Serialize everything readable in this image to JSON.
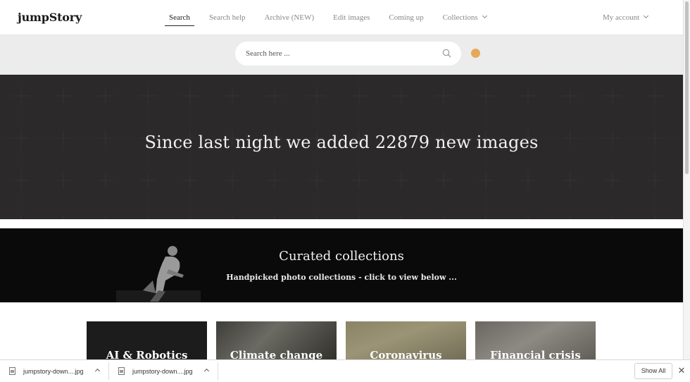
{
  "header": {
    "logo": "jumpStory",
    "nav": [
      {
        "label": "Search",
        "active": true
      },
      {
        "label": "Search help"
      },
      {
        "label": "Archive (NEW)"
      },
      {
        "label": "Edit images"
      },
      {
        "label": "Coming up"
      },
      {
        "label": "Collections",
        "has_dropdown": true
      }
    ],
    "account": "My account"
  },
  "search": {
    "placeholder": "Search here ...",
    "icon": "search-icon",
    "status_dot_color": "#e6a95a"
  },
  "hero": {
    "title": "Since last night we added 22879 new images"
  },
  "curated": {
    "title": "Curated collections",
    "subtitle": "Handpicked photo collections - click to view below ..."
  },
  "collections": [
    {
      "label": "AI & Robotics"
    },
    {
      "label": "Climate change"
    },
    {
      "label": "Coronavirus"
    },
    {
      "label": "Financial crisis"
    }
  ],
  "downloads": {
    "items": [
      {
        "name": "jumpstory-down....jpg"
      },
      {
        "name": "jumpstory-down....jpg"
      }
    ],
    "show_all": "Show All",
    "close": "✕"
  }
}
